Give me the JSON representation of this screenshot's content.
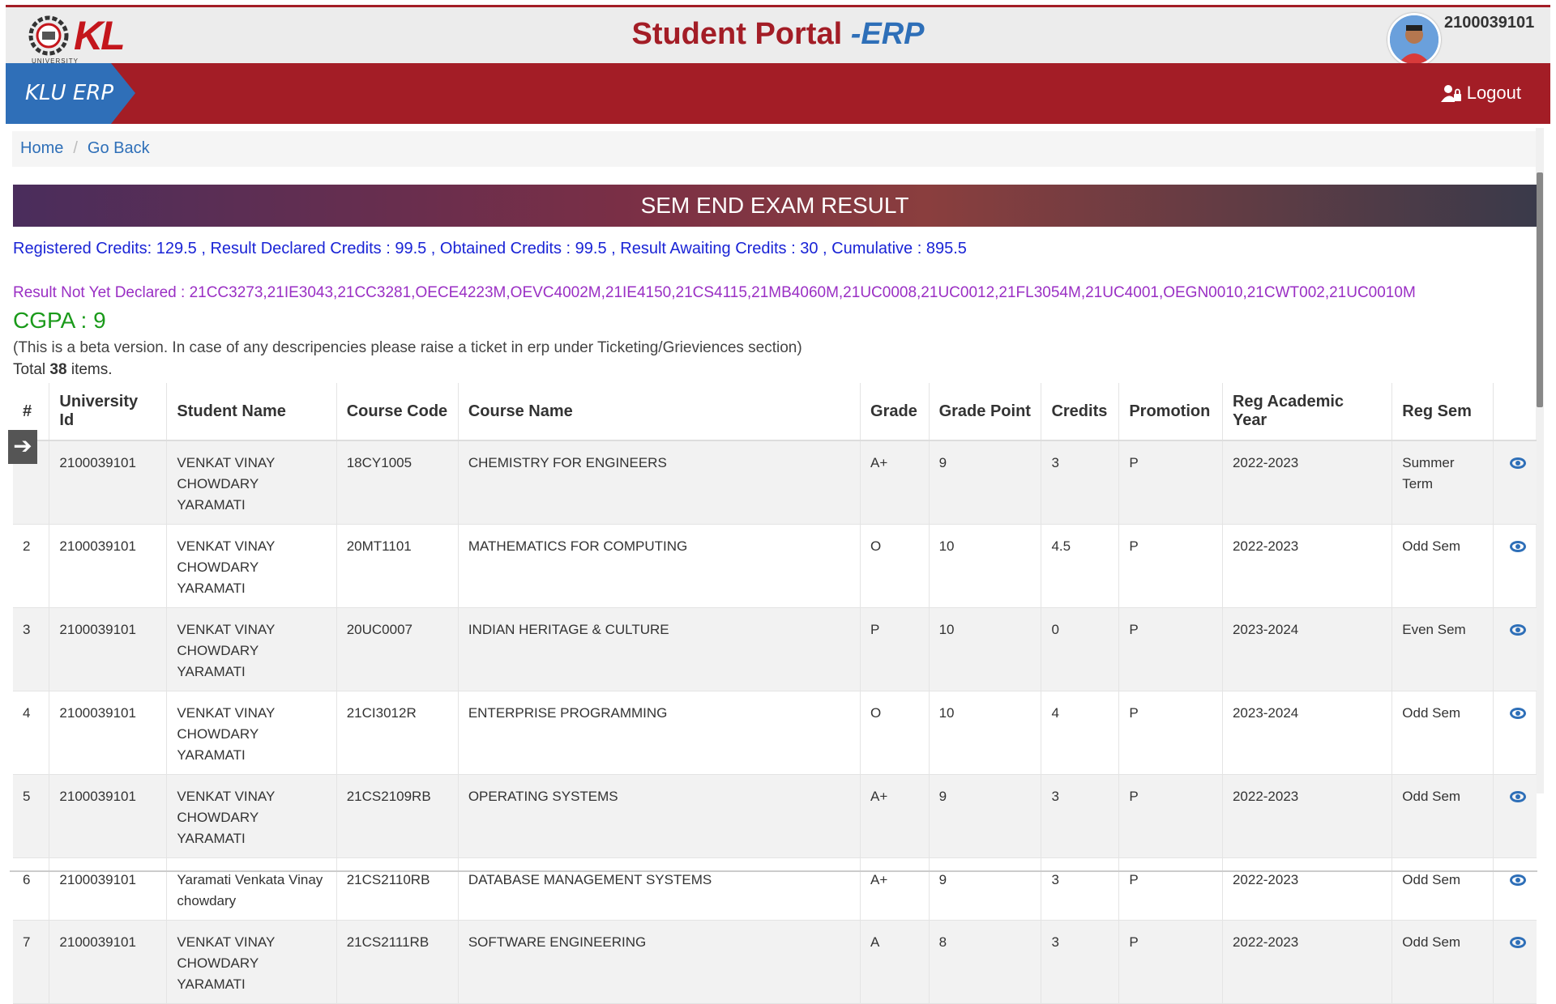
{
  "header": {
    "logo_text": "KL",
    "logo_sub": "UNIVERSITY",
    "title_main": "Student Portal",
    "title_erp": "-ERP",
    "user_id": "2100039101"
  },
  "navbar": {
    "brand": "KLU ERP",
    "logout": "Logout"
  },
  "breadcrumb": {
    "home": "Home",
    "separator": "/",
    "back": "Go Back"
  },
  "banner": "SEM END EXAM RESULT",
  "summary": {
    "credits": "Registered Credits: 129.5 , Result Declared Credits : 99.5 , Obtained Credits : 99.5 , Result Awaiting Credits : 30 ,   Cumulative : 895.5",
    "not_declared": "Result Not Yet Declared : 21CC3273,21IE3043,21CC3281,OECE4223M,OEVC4002M,21IE4150,21CS4115,21MB4060M,21UC0008,21UC0012,21FL3054M,21UC4001,OEGN0010,21CWT002,21UC0010M",
    "cgpa": "CGPA : 9",
    "beta_note": "(This is a beta version. In case of any descripencies please raise a ticket in erp under Ticketing/Grieviences section)",
    "total_prefix": "Total",
    "total_count": "38",
    "total_suffix": "items."
  },
  "table": {
    "headers": [
      "#",
      "University Id",
      "Student Name",
      "Course Code",
      "Course Name",
      "Grade",
      "Grade Point",
      "Credits",
      "Promotion",
      "Reg Academic Year",
      "Reg Sem"
    ],
    "rows": [
      {
        "n": "",
        "uid": "2100039101",
        "name": "VENKAT VINAY CHOWDARY YARAMATI",
        "code": "18CY1005",
        "course": "CHEMISTRY FOR ENGINEERS",
        "grade": "A+",
        "gp": "9",
        "credits": "3",
        "promo": "P",
        "year": "2022-2023",
        "sem": "Summer Term"
      },
      {
        "n": "2",
        "uid": "2100039101",
        "name": "VENKAT VINAY CHOWDARY YARAMATI",
        "code": "20MT1101",
        "course": "MATHEMATICS FOR COMPUTING",
        "grade": "O",
        "gp": "10",
        "credits": "4.5",
        "promo": "P",
        "year": "2022-2023",
        "sem": "Odd Sem"
      },
      {
        "n": "3",
        "uid": "2100039101",
        "name": "VENKAT VINAY CHOWDARY YARAMATI",
        "code": "20UC0007",
        "course": "INDIAN HERITAGE & CULTURE",
        "grade": "P",
        "gp": "10",
        "credits": "0",
        "promo": "P",
        "year": "2023-2024",
        "sem": "Even Sem"
      },
      {
        "n": "4",
        "uid": "2100039101",
        "name": "VENKAT VINAY CHOWDARY YARAMATI",
        "code": "21CI3012R",
        "course": "ENTERPRISE PROGRAMMING",
        "grade": "O",
        "gp": "10",
        "credits": "4",
        "promo": "P",
        "year": "2023-2024",
        "sem": "Odd Sem"
      },
      {
        "n": "5",
        "uid": "2100039101",
        "name": "VENKAT VINAY CHOWDARY YARAMATI",
        "code": "21CS2109RB",
        "course": "OPERATING SYSTEMS",
        "grade": "A+",
        "gp": "9",
        "credits": "3",
        "promo": "P",
        "year": "2022-2023",
        "sem": "Odd Sem"
      },
      {
        "n": "6",
        "uid": "2100039101",
        "name": "Yaramati Venkata Vinay chowdary",
        "code": "21CS2110RB",
        "course": "DATABASE MANAGEMENT SYSTEMS",
        "grade": "A+",
        "gp": "9",
        "credits": "3",
        "promo": "P",
        "year": "2022-2023",
        "sem": "Odd Sem"
      },
      {
        "n": "7",
        "uid": "2100039101",
        "name": "VENKAT VINAY CHOWDARY YARAMATI",
        "code": "21CS2111RB",
        "course": "SOFTWARE ENGINEERING",
        "grade": "A",
        "gp": "8",
        "credits": "3",
        "promo": "P",
        "year": "2022-2023",
        "sem": "Odd Sem"
      }
    ]
  }
}
